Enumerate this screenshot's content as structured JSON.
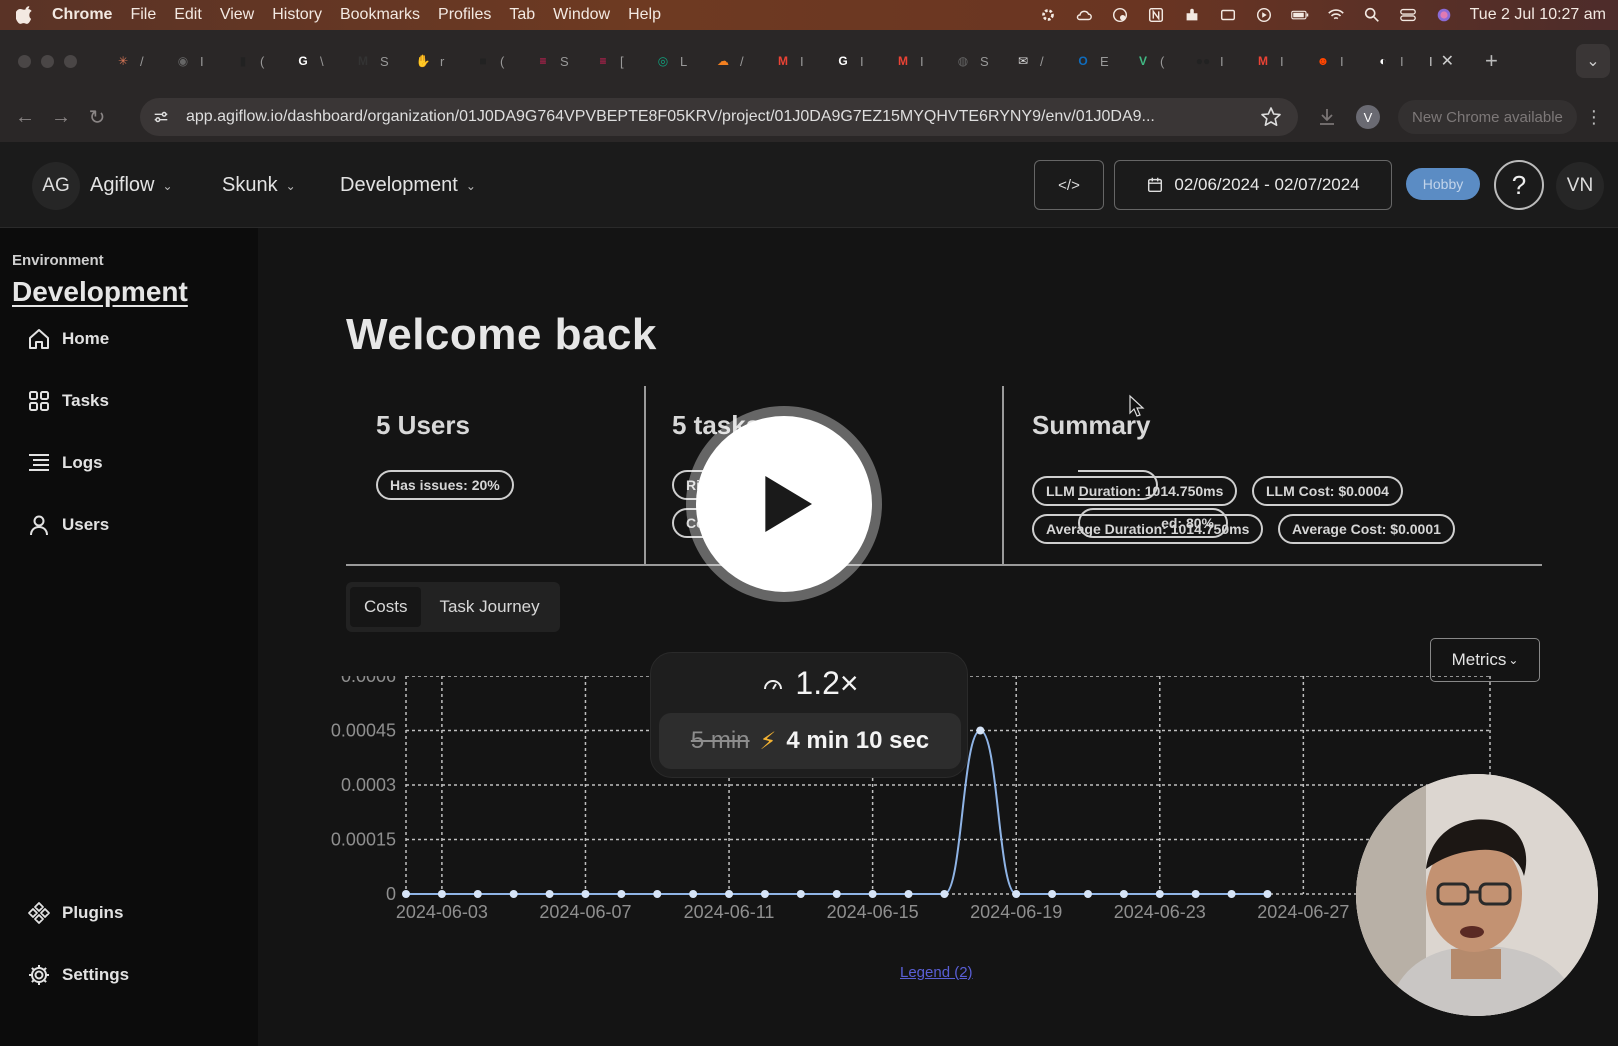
{
  "menubar": {
    "app": "Chrome",
    "items": [
      "File",
      "Edit",
      "View",
      "History",
      "Bookmarks",
      "Profiles",
      "Tab",
      "Window",
      "Help"
    ],
    "clock": "Tue 2 Jul  10:27 am"
  },
  "tabbar": {
    "tabs": [
      {
        "icon": "claude-icon",
        "color": "#d97757",
        "glyph": "✳",
        "label": "/"
      },
      {
        "icon": "chrome-icon",
        "color": "#666",
        "glyph": "◉",
        "label": "I"
      },
      {
        "icon": "terminal-icon",
        "color": "#222",
        "glyph": "▮",
        "label": "("
      },
      {
        "icon": "google-icon",
        "color": "#fff",
        "glyph": "G",
        "label": "\\"
      },
      {
        "icon": "medium-icon",
        "color": "#333",
        "glyph": "M",
        "label": "S"
      },
      {
        "icon": "hand-icon",
        "color": "#d4803c",
        "glyph": "✋",
        "label": "r"
      },
      {
        "icon": "square-icon",
        "color": "#222",
        "glyph": "■",
        "label": "("
      },
      {
        "icon": "slack-icon",
        "color": "#e01e5a",
        "glyph": "≡",
        "label": "S"
      },
      {
        "icon": "slack-icon",
        "color": "#e01e5a",
        "glyph": "≡",
        "label": "["
      },
      {
        "icon": "openai-icon",
        "color": "#10a37f",
        "glyph": "◎",
        "label": "L"
      },
      {
        "icon": "cloud-icon",
        "color": "#f38020",
        "glyph": "☁",
        "label": "/"
      },
      {
        "icon": "gmail-icon",
        "color": "#ea4335",
        "glyph": "M",
        "label": "I"
      },
      {
        "icon": "google-icon",
        "color": "#fff",
        "glyph": "G",
        "label": "I"
      },
      {
        "icon": "gmail-icon",
        "color": "#ea4335",
        "glyph": "M",
        "label": "I"
      },
      {
        "icon": "globe-icon",
        "color": "#666",
        "glyph": "◍",
        "label": "S"
      },
      {
        "icon": "inbox-icon",
        "color": "#ddd",
        "glyph": "✉",
        "label": "/"
      },
      {
        "icon": "outlook-icon",
        "color": "#0f6cbd",
        "glyph": "O",
        "label": "E"
      },
      {
        "icon": "vuejs-icon",
        "color": "#41b883",
        "glyph": "V",
        "label": "("
      },
      {
        "icon": "loom-icon",
        "color": "#222",
        "glyph": "●●",
        "label": "I"
      },
      {
        "icon": "gmail-icon",
        "color": "#ea4335",
        "glyph": "M",
        "label": "I"
      },
      {
        "icon": "reddit-icon",
        "color": "#ff4500",
        "glyph": "☻",
        "label": "I"
      },
      {
        "icon": "github-icon",
        "color": "#fff",
        "glyph": "◐",
        "label": "I"
      }
    ],
    "active_label": "I"
  },
  "urlbar": {
    "url": "app.agiflow.io/dashboard/organization/01J0DA9G764VPVBEPTE8F05KRV/project/01J0DA9G7EZ15MYQHVTE6RYNY9/env/01J0DA9...",
    "profile_initial": "V",
    "update_label": "New Chrome available"
  },
  "header": {
    "org_initials": "AG",
    "org_name": "Agiflow",
    "project": "Skunk",
    "environment": "Development",
    "code_label": "</>",
    "date_range": "02/06/2024 - 02/07/2024",
    "plan_badge": "Hobby",
    "help": "?",
    "user_initials": "VN"
  },
  "sidebar": {
    "env_label": "Environment",
    "env_name": "Development",
    "items": [
      {
        "label": "Home",
        "icon": "home-icon"
      },
      {
        "label": "Tasks",
        "icon": "grid-icon"
      },
      {
        "label": "Logs",
        "icon": "list-icon"
      },
      {
        "label": "Users",
        "icon": "user-icon"
      }
    ],
    "bottom_items": [
      {
        "label": "Plugins",
        "icon": "plugins-icon"
      },
      {
        "label": "Settings",
        "icon": "gear-icon"
      }
    ]
  },
  "main": {
    "title": "Welcome back",
    "users_panel": {
      "title": "5 Users",
      "pills": [
        "Has issues: 20%"
      ]
    },
    "tasks_panel": {
      "title": "5 tasks",
      "pills": [
        "Risky",
        "Com",
        "ed: 80%"
      ]
    },
    "summary_panel": {
      "title": "Summary",
      "pills": [
        "LLM Duration: 1014.750ms",
        "LLM Cost: $0.0004",
        "Average Duration: 1014.750ms",
        "Average Cost: $0.0001"
      ]
    },
    "tabs": [
      {
        "label": "Costs",
        "active": true
      },
      {
        "label": "Task Journey",
        "active": false
      }
    ],
    "metrics_label": "Metrics",
    "legend_label": "Legend (2)"
  },
  "chart_data": {
    "type": "line",
    "title": "",
    "xlabel": "",
    "ylabel": "",
    "ylim": [
      0,
      0.0006
    ],
    "ytick_labels": [
      "0",
      "0.00015",
      "0.0003",
      "0.00045",
      "0.0006"
    ],
    "xtick_labels": [
      "2024-06-03",
      "2024-06-07",
      "2024-06-11",
      "2024-06-15",
      "2024-06-19",
      "2024-06-23",
      "2024-06-27"
    ],
    "x": [
      "2024-06-02",
      "2024-06-03",
      "2024-06-04",
      "2024-06-05",
      "2024-06-06",
      "2024-06-07",
      "2024-06-08",
      "2024-06-09",
      "2024-06-10",
      "2024-06-11",
      "2024-06-12",
      "2024-06-13",
      "2024-06-14",
      "2024-06-15",
      "2024-06-16",
      "2024-06-17",
      "2024-06-18",
      "2024-06-19",
      "2024-06-20",
      "2024-06-21",
      "2024-06-22",
      "2024-06-23",
      "2024-06-24",
      "2024-06-25",
      "2024-06-26"
    ],
    "series": [
      {
        "values": [
          0,
          0,
          0,
          0,
          0,
          0,
          0,
          0,
          0,
          0,
          0,
          0,
          0,
          0,
          0,
          0,
          0.00045,
          0,
          0,
          0,
          0,
          0,
          0,
          0,
          0
        ],
        "color": "#8fb4e6"
      }
    ],
    "grid": true
  },
  "video_overlay": {
    "speed": "1.2×",
    "original_time": "5 min",
    "new_time": "4 min 10 sec"
  }
}
